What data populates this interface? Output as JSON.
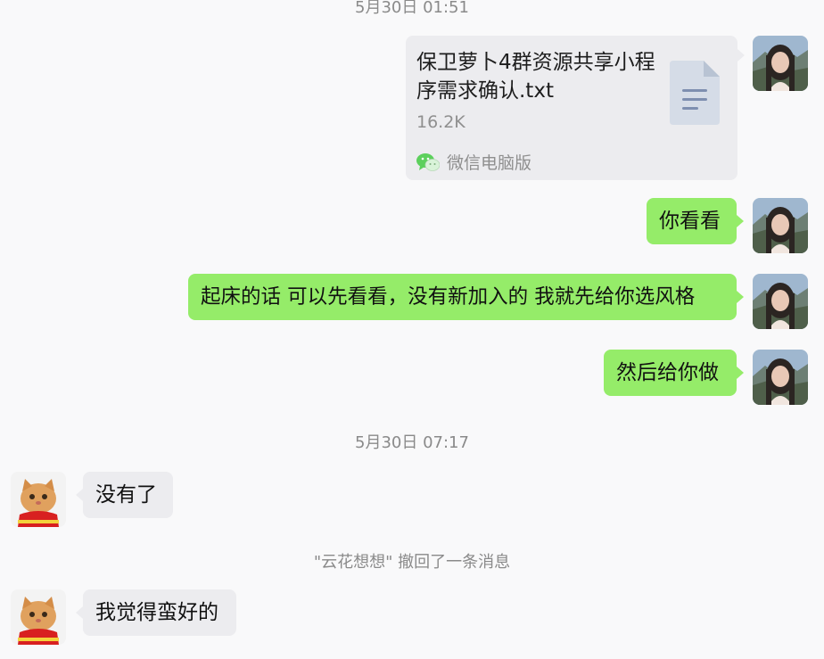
{
  "timestamps": {
    "t1": "5月30日 01:51",
    "t2": "5月30日 07:17"
  },
  "file_message": {
    "name": "保卫萝卜4群资源共享小程序需求确认.txt",
    "size": "16.2K",
    "source_app": "微信电脑版",
    "file_icon": "txt-document-icon",
    "source_icon": "wechat-icon"
  },
  "messages": [
    {
      "from": "me",
      "text": "你看看"
    },
    {
      "from": "me",
      "text": "起床的话 可以先看看，没有新加入的 我就先给你选风格"
    },
    {
      "from": "me",
      "text": "然后给你做"
    },
    {
      "from": "them",
      "text": "没有了"
    },
    {
      "from": "them",
      "text": "我觉得蛮好的"
    }
  ],
  "system_notice": "\"云花想想\" 撤回了一条消息",
  "colors": {
    "my_bubble": "#95ec69",
    "their_bubble": "#ececef",
    "background": "#f9f9fa"
  },
  "avatars": {
    "me": "girl-portrait-avatar",
    "them": "cat-avatar"
  }
}
